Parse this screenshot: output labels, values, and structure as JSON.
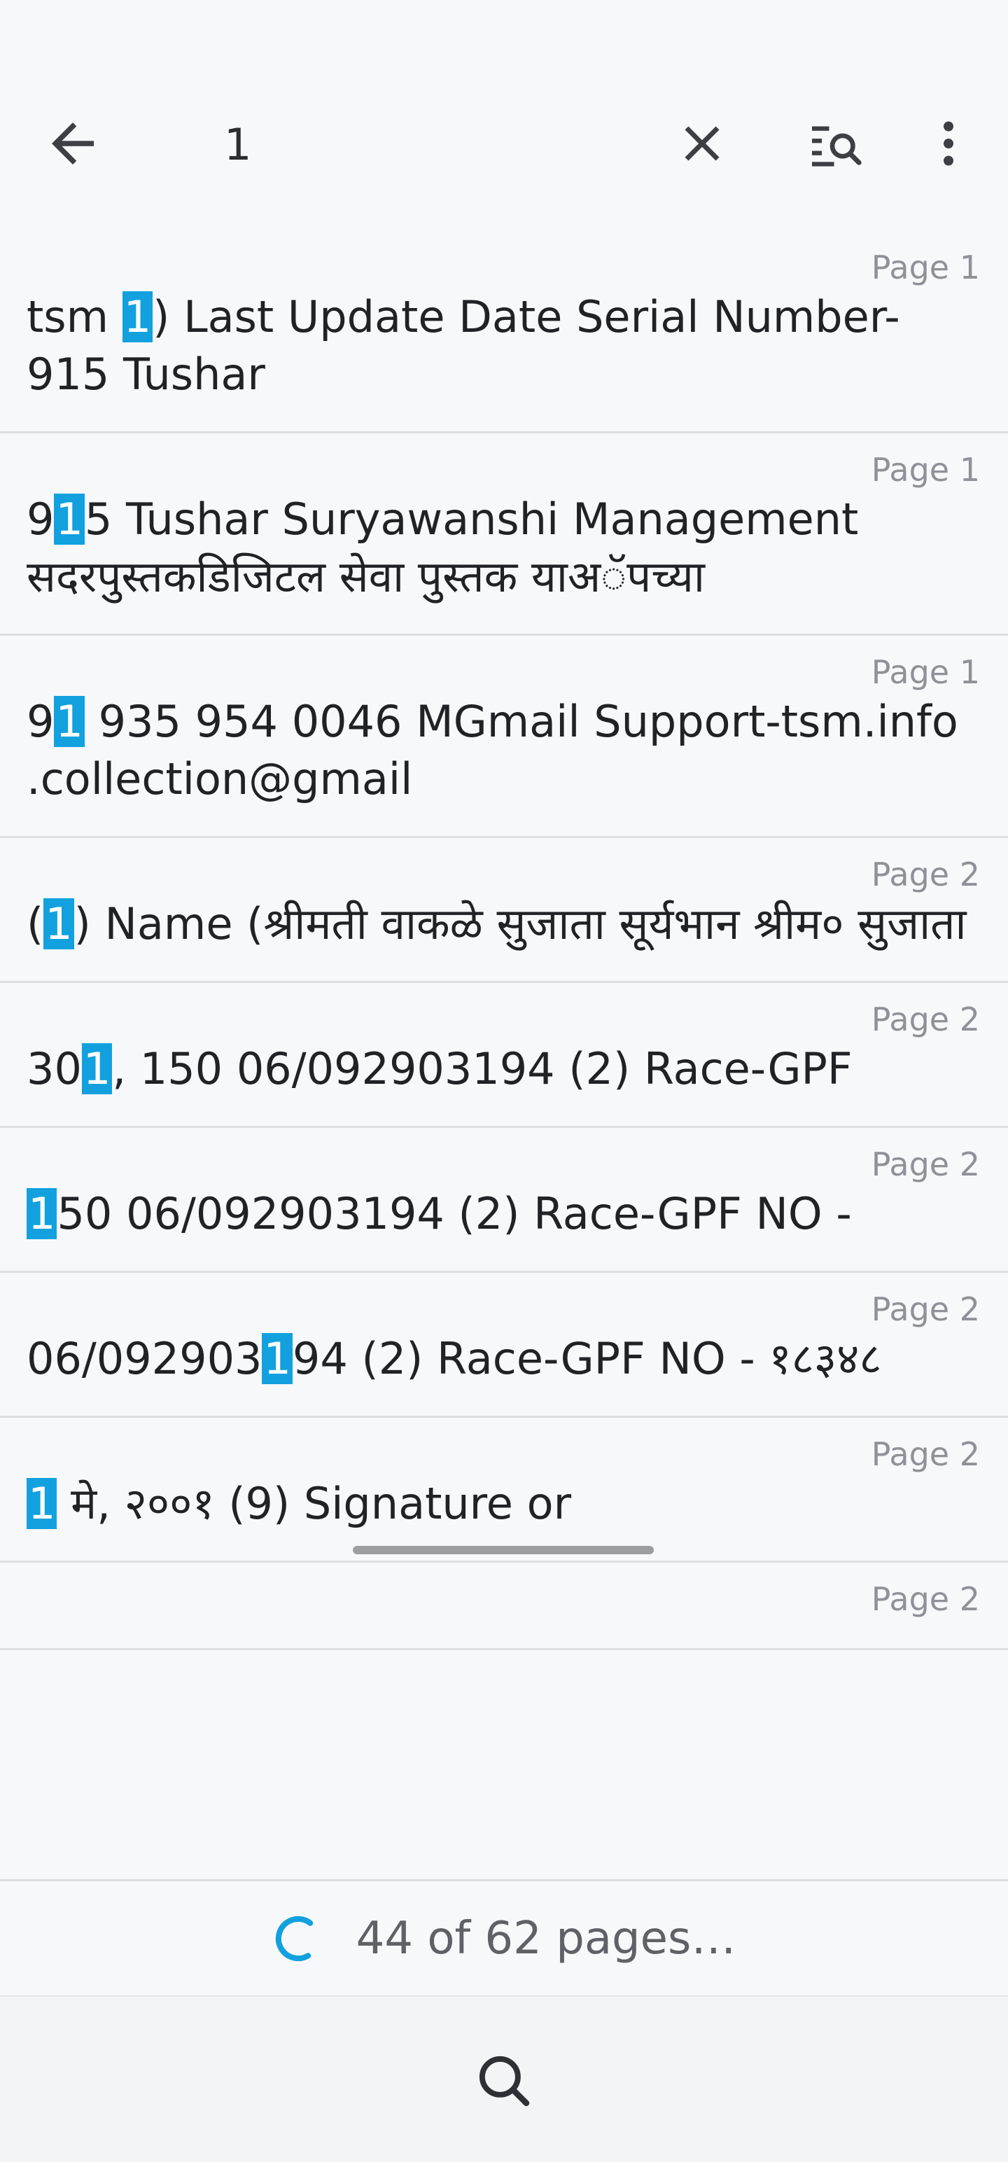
{
  "search": {
    "query": "1"
  },
  "icons": {
    "back": "arrow-left-icon",
    "clear": "close-icon",
    "filter": "list-search-icon",
    "more": "more-vertical-icon",
    "bottom_search": "search-icon",
    "spinner": "loading-spinner-icon"
  },
  "colors": {
    "highlight": "#12a1de",
    "background": "#f7f8fa",
    "divider": "#dcdee2",
    "page_label": "#8e9298",
    "spinner": "#12a1de"
  },
  "results": [
    {
      "page": "Page 1",
      "before": "tsm ",
      "match": "1",
      "after": ") Last Update Date Serial Number- 915 Tushar"
    },
    {
      "page": "Page 1",
      "before": "9",
      "match": "1",
      "after": "5 Tushar Suryawanshi Management सदरपुस्तकडिजिटल सेवा पुस्तक याअॅपच्या"
    },
    {
      "page": "Page 1",
      "before": "9",
      "match": "1",
      "after": " 935 954 0046 MGmail Support-tsm.info .collection@gmail"
    },
    {
      "page": "Page 2",
      "before": "(",
      "match": "1",
      "after": ") Name (श्रीमती वाकळे सुजाता सूर्यभान श्रीम० सुजाता"
    },
    {
      "page": "Page 2",
      "before": "30",
      "match": "1",
      "after": ", 150 06/092903194 (2) Race-GPF"
    },
    {
      "page": "Page 2",
      "before": "",
      "match": "1",
      "after": "50 06/092903194 (2) Race-GPF NO -"
    },
    {
      "page": "Page 2",
      "before": "06/092903",
      "match": "1",
      "after": "94 (2) Race-GPF NO - १८३४८"
    },
    {
      "page": "Page 2",
      "before": "",
      "match": "1",
      "after": " मे, २००१ (9) Signature or"
    },
    {
      "page": "Page 2",
      "before": "",
      "match": "",
      "after": ""
    }
  ],
  "progress": {
    "text": "44 of 62 pages…"
  }
}
